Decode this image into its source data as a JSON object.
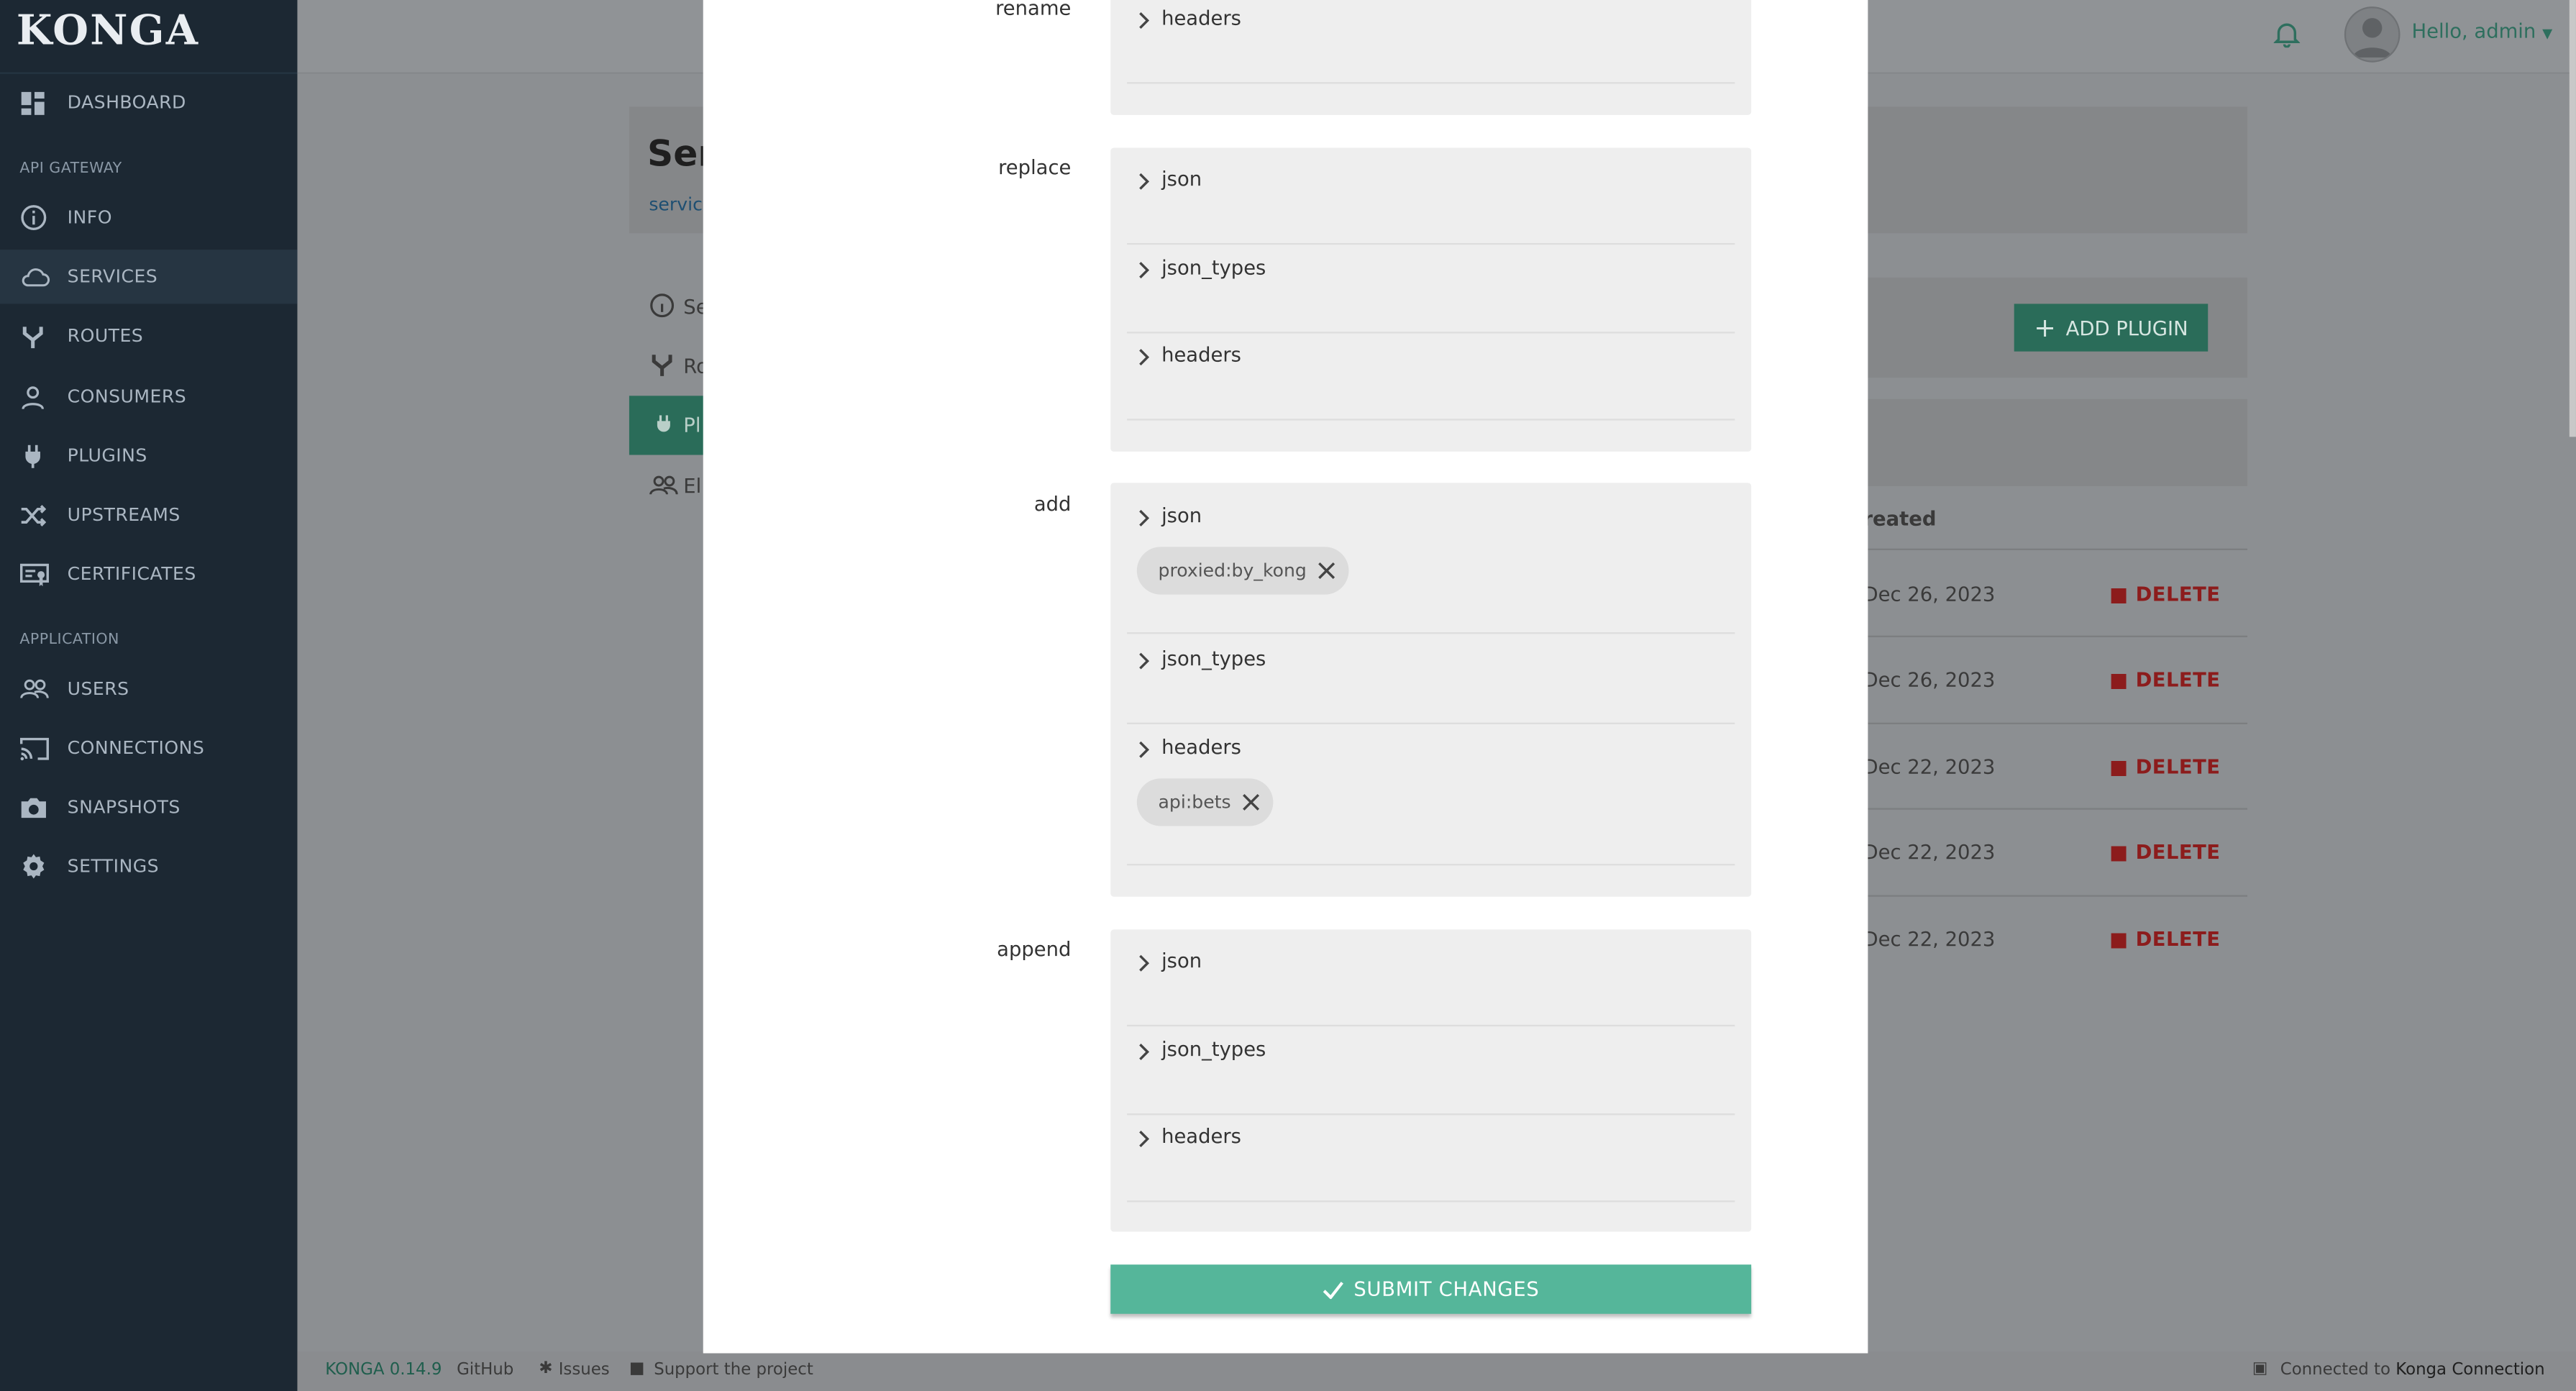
{
  "app": {
    "logo": "KONGA",
    "brand_color": "#55b69a"
  },
  "sidebar": {
    "items_top": [
      {
        "label": "DASHBOARD",
        "icon": "dashboard-icon"
      }
    ],
    "section_gateway": "API GATEWAY",
    "items_gateway": [
      {
        "label": "INFO",
        "icon": "info-icon"
      },
      {
        "label": "SERVICES",
        "icon": "cloud-icon",
        "active": true
      },
      {
        "label": "ROUTES",
        "icon": "routes-icon"
      },
      {
        "label": "CONSUMERS",
        "icon": "user-icon"
      },
      {
        "label": "PLUGINS",
        "icon": "plug-icon"
      },
      {
        "label": "UPSTREAMS",
        "icon": "shuffle-icon"
      },
      {
        "label": "CERTIFICATES",
        "icon": "certificate-icon"
      }
    ],
    "section_app": "APPLICATION",
    "items_app": [
      {
        "label": "USERS",
        "icon": "users-icon"
      },
      {
        "label": "CONNECTIONS",
        "icon": "cast-icon"
      },
      {
        "label": "SNAPSHOTS",
        "icon": "camera-icon"
      },
      {
        "label": "SETTINGS",
        "icon": "gear-icon"
      }
    ]
  },
  "topbar": {
    "greeting": "Hello, admin"
  },
  "background_page": {
    "title": "Ser",
    "breadcrumb": "service",
    "tabs": [
      "Se",
      "Ro",
      "Pl",
      "El"
    ],
    "add_plugin_label": "ADD PLUGIN",
    "created_header": "reated",
    "rows": [
      {
        "created": "Dec 26, 2023",
        "action": "DELETE"
      },
      {
        "created": "Dec 26, 2023",
        "action": "DELETE"
      },
      {
        "created": "Dec 22, 2023",
        "action": "DELETE"
      },
      {
        "created": "Dec 22, 2023",
        "action": "DELETE"
      },
      {
        "created": "Dec 22, 2023",
        "action": "DELETE"
      }
    ]
  },
  "modal": {
    "sections": {
      "rename": {
        "label": "rename",
        "fields": [
          {
            "name": "headers",
            "chips": []
          }
        ]
      },
      "replace": {
        "label": "replace",
        "fields": [
          {
            "name": "json",
            "chips": []
          },
          {
            "name": "json_types",
            "chips": []
          },
          {
            "name": "headers",
            "chips": []
          }
        ]
      },
      "add": {
        "label": "add",
        "fields": [
          {
            "name": "json",
            "chips": [
              "proxied:by_kong"
            ]
          },
          {
            "name": "json_types",
            "chips": []
          },
          {
            "name": "headers",
            "chips": [
              "api:bets"
            ]
          }
        ]
      },
      "append": {
        "label": "append",
        "fields": [
          {
            "name": "json",
            "chips": []
          },
          {
            "name": "json_types",
            "chips": []
          },
          {
            "name": "headers",
            "chips": []
          }
        ]
      }
    },
    "submit_label": "SUBMIT CHANGES"
  },
  "footer": {
    "version": "KONGA 0.14.9",
    "github": "GitHub",
    "issues": "Issues",
    "support": "Support the project",
    "connected_prefix": "Connected to",
    "connection_name": "Konga Connection"
  }
}
